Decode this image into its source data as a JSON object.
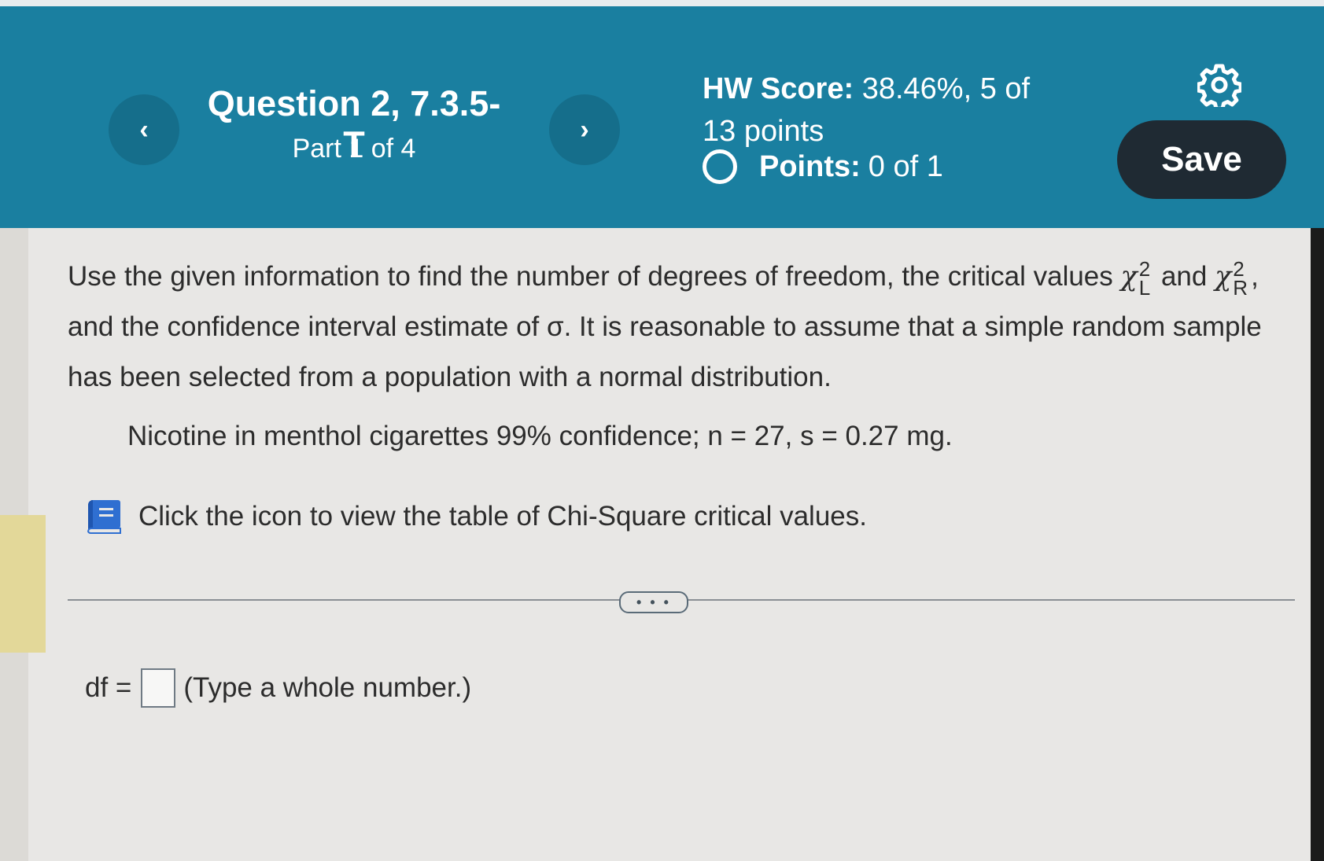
{
  "header": {
    "prev_icon": "‹",
    "next_icon": "›",
    "question_title": "Question 2, 7.3.5-T",
    "question_part": "Part 1 of 4",
    "hw_score_label": "HW Score:",
    "hw_score_value": "38.46%, 5 of",
    "hw_score_value2": "13 points",
    "points_label": "Points:",
    "points_value": "0 of 1",
    "save_label": "Save",
    "accent_color": "#1a7fa0"
  },
  "problem": {
    "text_1": "Use the given information to find the number of degrees of freedom, the critical values",
    "chi_symbol": "χ",
    "chi_sup": "2",
    "chi_left_sub": "L",
    "text_and": "and",
    "chi_right_sub": "R",
    "text_2": ", and the confidence interval estimate of σ. It is reasonable to assume that a simple random sample has been selected from a population with a normal distribution.",
    "given": "Nicotine in menthol cigarettes 99% confidence; n = 27, s = 0.27 mg.",
    "table_link": "Click the icon to view the table of Chi-Square critical values."
  },
  "more_button": "• • •",
  "answer": {
    "label": "df =",
    "hint": "(Type a whole number.)"
  }
}
